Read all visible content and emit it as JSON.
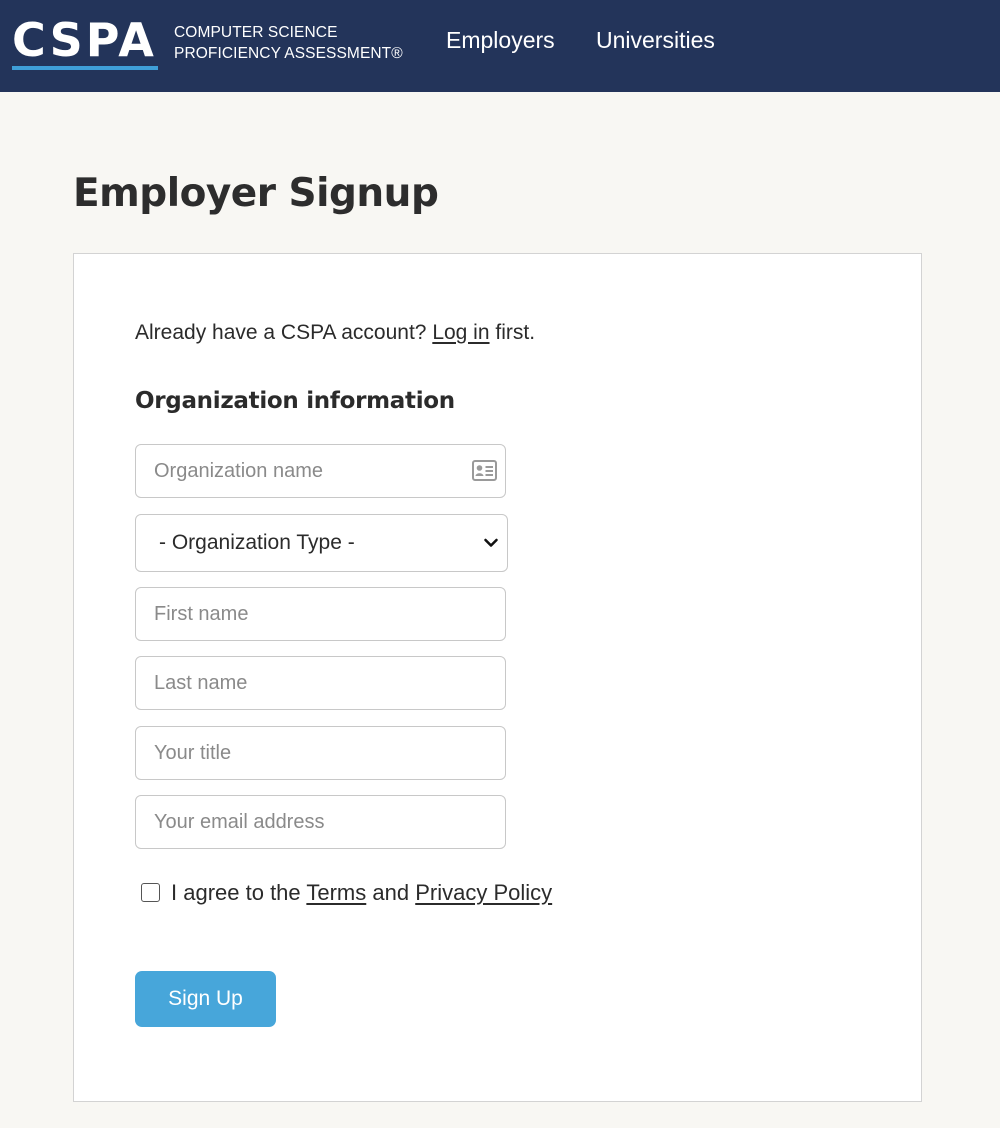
{
  "header": {
    "logo_mark": "CSPA",
    "logo_line1": "COMPUTER SCIENCE",
    "logo_line2": "PROFICIENCY ASSESSMENT®",
    "nav": [
      {
        "label": "Employers"
      },
      {
        "label": "Universities"
      }
    ],
    "colors": {
      "background": "#23345a",
      "accent": "#3f9fd8"
    }
  },
  "page": {
    "title": "Employer Signup"
  },
  "form": {
    "already_prefix": "Already have a CSPA account?",
    "login_link": "Log in",
    "already_suffix": "first.",
    "section_heading": "Organization information",
    "org_name": {
      "placeholder": "Organization name",
      "value": "",
      "icon": "contact-card-icon"
    },
    "org_type": {
      "selected": "- Organization Type -"
    },
    "first_name": {
      "placeholder": "First name",
      "value": ""
    },
    "last_name": {
      "placeholder": "Last name",
      "value": ""
    },
    "title": {
      "placeholder": "Your title",
      "value": ""
    },
    "email": {
      "placeholder": "Your email address",
      "value": ""
    },
    "agree": {
      "prefix": "I agree to the",
      "terms_link": "Terms",
      "and": "and",
      "privacy_link": "Privacy Policy",
      "checked": false
    },
    "submit_label": "Sign Up",
    "button_color": "#47a6da"
  }
}
